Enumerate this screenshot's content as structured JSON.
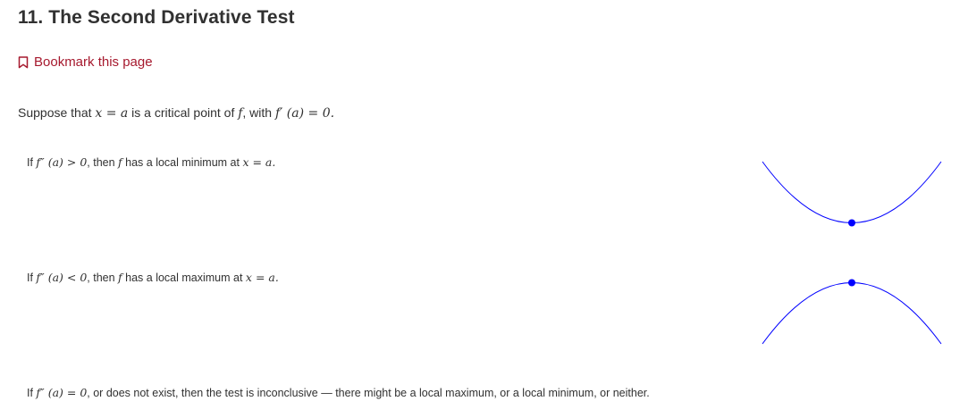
{
  "header": {
    "title": "11. The Second Derivative Test"
  },
  "bookmark": {
    "label": "Bookmark this page",
    "icon": "bookmark-icon",
    "color": "#a6192e"
  },
  "intro": {
    "t1": "Suppose that ",
    "m1": "x = a",
    "t2": " is a critical point of ",
    "m2": "f",
    "t3": ", with ",
    "m3": "f′ (a) = 0.",
    "t4": ""
  },
  "cases": [
    {
      "t1": "If ",
      "m1": "f″ (a) > 0",
      "t2": ", then ",
      "m2": "f",
      "t3": " has a local minimum at ",
      "m3": "x = a.",
      "t4": "",
      "graph_shape": "upward parabola with minimum point"
    },
    {
      "t1": "If ",
      "m1": "f″ (a) < 0",
      "t2": ", then ",
      "m2": "f",
      "t3": " has a local maximum at ",
      "m3": "x = a.",
      "t4": "",
      "graph_shape": "downward parabola with maximum point"
    },
    {
      "t1": "If ",
      "m1": "f″ (a) = 0",
      "t2": ", or does not exist, then the test is inconclusive — there might be a local maximum, or a local minimum, or neither.",
      "m2": "",
      "t3": "",
      "m3": "",
      "t4": ""
    }
  ],
  "colors": {
    "curve": "#0000ff",
    "point": "#0000ff",
    "accent": "#a6192e"
  }
}
